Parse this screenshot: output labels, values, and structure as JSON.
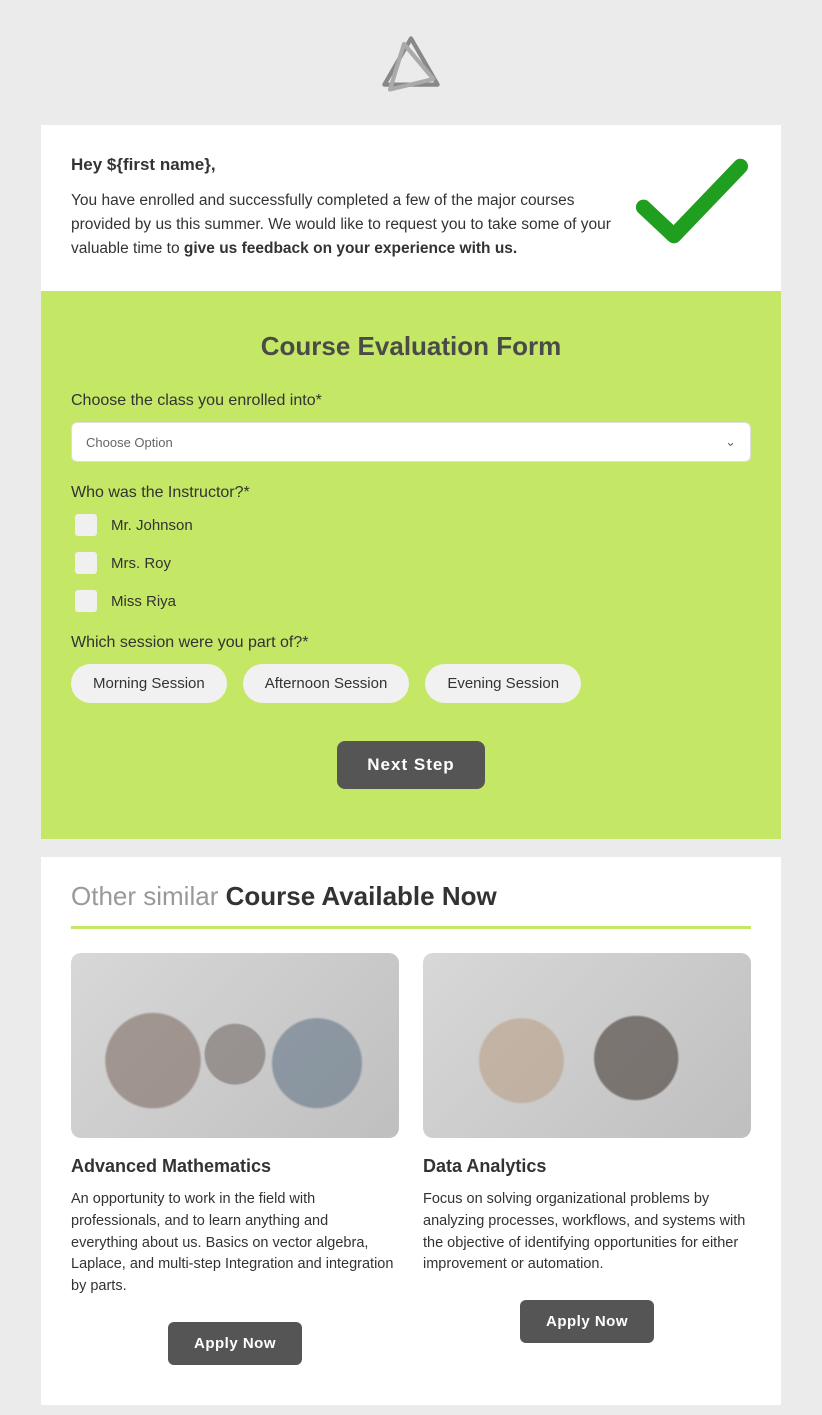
{
  "intro": {
    "greeting": "Hey ${first name},",
    "body_1": "You have enrolled and successfully completed a few of the major courses provided by us this summer. We would like to request you to take some of your valuable time to ",
    "body_bold": "give us feedback on your experience with us."
  },
  "form": {
    "title": "Course Evaluation Form",
    "q1_label": "Choose the class you enrolled into*",
    "q1_placeholder": "Choose Option",
    "q2_label": "Who was the Instructor?*",
    "instructors": [
      "Mr. Johnson",
      "Mrs. Roy",
      "Miss Riya"
    ],
    "q3_label": "Which session were you part of?*",
    "sessions": [
      "Morning Session",
      "Afternoon Session",
      "Evening Session"
    ],
    "next_button": "Next Step"
  },
  "courses_section": {
    "heading_light": "Other similar ",
    "heading_bold": "Course Available Now",
    "courses": [
      {
        "title": "Advanced Mathematics",
        "desc": "An opportunity to work in the field with professionals, and to learn anything and everything about us. Basics on vector algebra, Laplace, and multi-step Integration and integration by parts.",
        "button": "Apply Now"
      },
      {
        "title": "Data Analytics",
        "desc": "Focus on solving organizational problems by analyzing processes, workflows, and systems with the objective of identifying opportunities for either improvement or automation.",
        "button": "Apply Now"
      }
    ]
  }
}
